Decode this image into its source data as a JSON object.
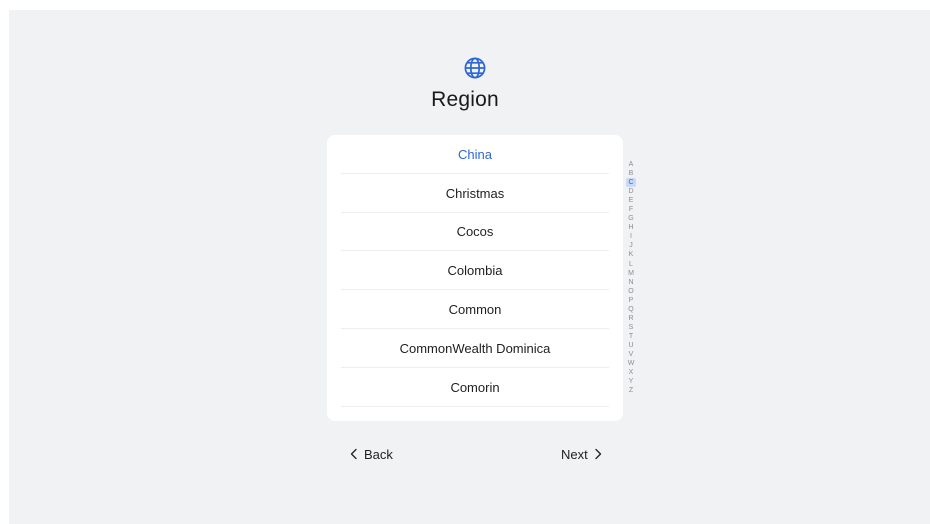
{
  "header": {
    "icon": "globe-icon",
    "title": "Region",
    "accent_color": "#2f66d6"
  },
  "region_list": {
    "selected": "China",
    "items": [
      {
        "label": "China",
        "selected": true
      },
      {
        "label": "Christmas",
        "selected": false
      },
      {
        "label": "Cocos",
        "selected": false
      },
      {
        "label": "Colombia",
        "selected": false
      },
      {
        "label": "Common",
        "selected": false
      },
      {
        "label": "CommonWealth Dominica",
        "selected": false
      },
      {
        "label": "Comorin",
        "selected": false
      }
    ]
  },
  "alphabet_index": {
    "active": "C",
    "letters": [
      "A",
      "B",
      "C",
      "D",
      "E",
      "F",
      "G",
      "H",
      "I",
      "J",
      "K",
      "L",
      "M",
      "N",
      "O",
      "P",
      "Q",
      "R",
      "S",
      "T",
      "U",
      "V",
      "W",
      "X",
      "Y",
      "Z"
    ]
  },
  "footer": {
    "back_label": "Back",
    "back_icon": "chevron-left-icon",
    "next_label": "Next",
    "next_icon": "chevron-right-icon"
  }
}
